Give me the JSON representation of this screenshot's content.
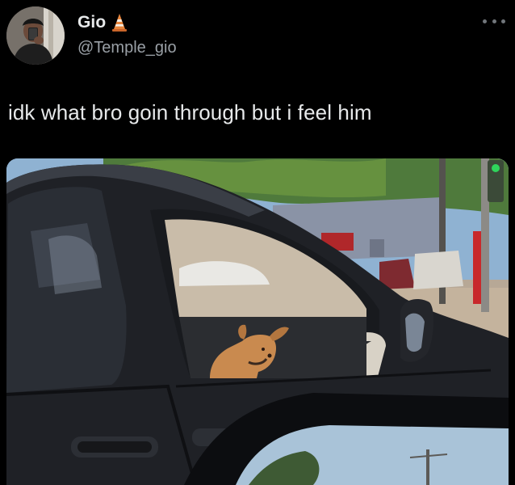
{
  "tweet": {
    "author": {
      "display_name": "Gio",
      "handle": "@Temple_gio",
      "avatar_icon": "profile-photo-avatar",
      "name_badge_icon": "traffic-cone-emoji"
    },
    "more_icon": "more-options-icon",
    "text": "idk what bro goin through but i feel him",
    "media": {
      "type": "photo",
      "icon": "photo-media"
    }
  },
  "colors": {
    "background": "#000000",
    "text_primary": "#e7e9ea",
    "text_secondary": "#9aa0a6"
  }
}
